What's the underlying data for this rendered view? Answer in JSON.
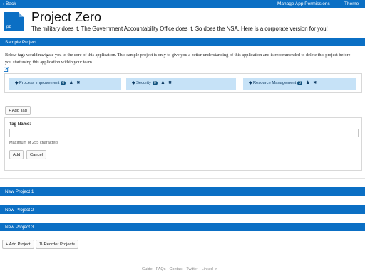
{
  "topbar": {
    "back_label": "Back",
    "manage_label": "Manage App Permissions",
    "theme_label": "Theme"
  },
  "project": {
    "logo_text": "pz",
    "title": "Project Zero",
    "subtitle": "The military does it. The Government Accountability Office does it. So does the NSA. Here is a corporate version for you!"
  },
  "sample_project": {
    "header": "Sample Project",
    "description": "Below tags would navigate you to the core of this application. This sample project is only to give you a better understanding of this application and is recommended to delete this project before you start using this application within your team.",
    "tags": [
      {
        "label": "Process Improvement",
        "count": "0"
      },
      {
        "label": "Security",
        "count": "0"
      },
      {
        "label": "Resource Management",
        "count": "0"
      }
    ],
    "add_tag_label": "Add Tag",
    "form": {
      "label": "Tag Name:",
      "value": "",
      "placeholder": "",
      "help": "Maximum of 255 characters",
      "add_label": "Add",
      "cancel_label": "Cancel"
    }
  },
  "projects": [
    {
      "header": "New Project 1"
    },
    {
      "header": "New Project 2"
    },
    {
      "header": "New Project 3"
    }
  ],
  "actions": {
    "add_project_label": "Add Project",
    "reorder_label": "Reorder Projects"
  },
  "footer": {
    "links": [
      "Guide",
      "FAQs",
      "Contact",
      "Twitter",
      "Linked-In"
    ]
  },
  "colors": {
    "primary": "#0b6fc4",
    "tag_background": "#c6e2f7",
    "badge": "#12537f"
  }
}
